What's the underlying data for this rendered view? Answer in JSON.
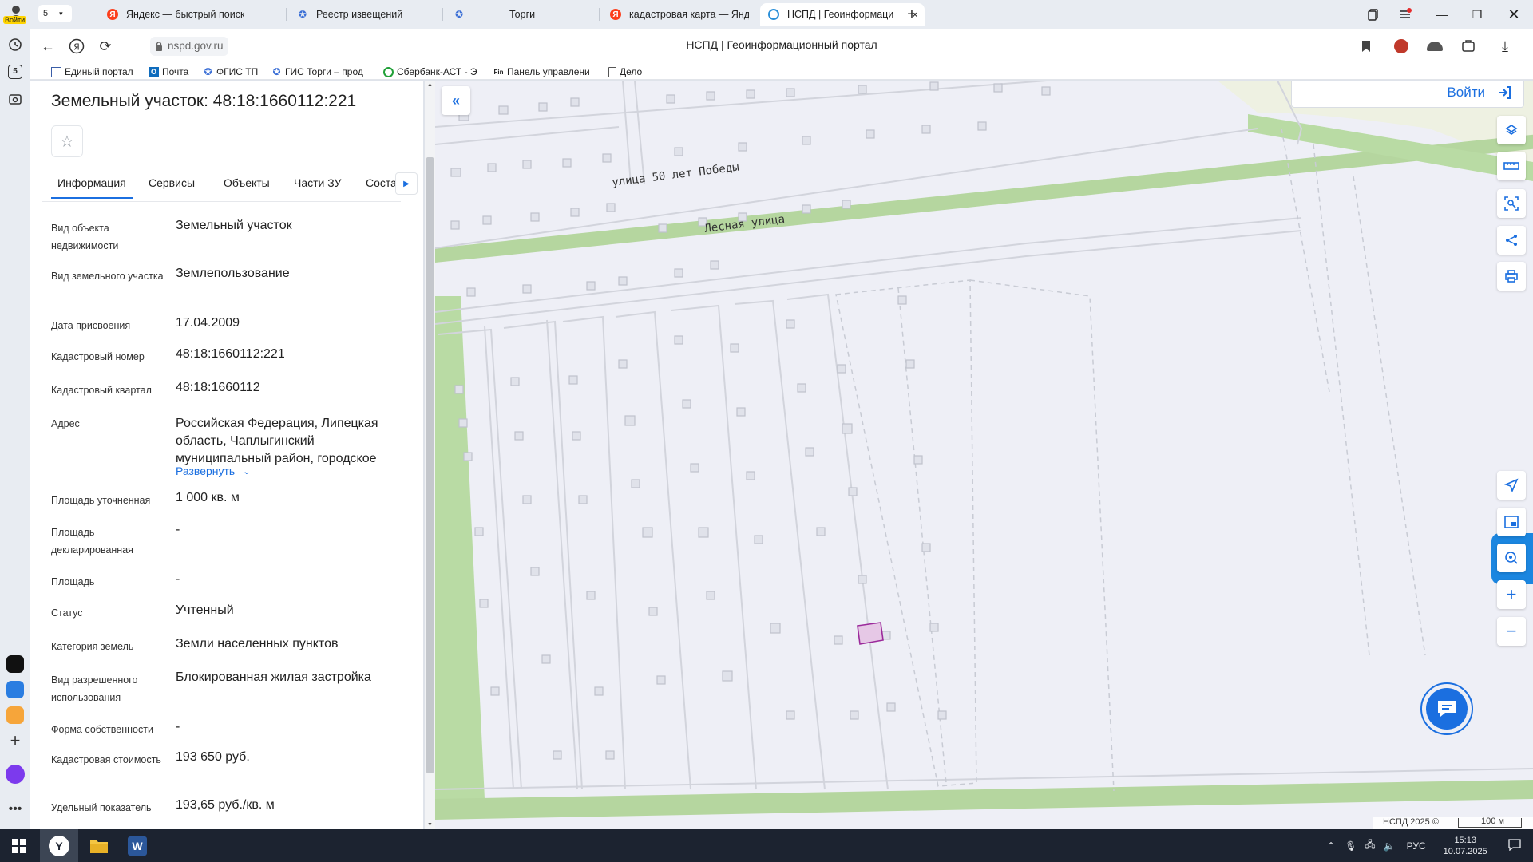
{
  "browser": {
    "profile_label": "Войти",
    "tab_counter": "5",
    "tabs": [
      {
        "title": "Яндекс — быстрый поиск"
      },
      {
        "title": "Реестр извещений"
      },
      {
        "title": "Торги"
      },
      {
        "title": "кадастровая карта — Янд"
      },
      {
        "title": "НСПД | Геоинформаци"
      }
    ],
    "url": "nspd.gov.ru",
    "page_title": "НСПД | Геоинформационный портал",
    "bookmarks": [
      {
        "label": "Единый портал"
      },
      {
        "label": "Почта"
      },
      {
        "label": "ФГИС ТП"
      },
      {
        "label": "ГИС Торги – прод"
      },
      {
        "label": "Сбербанк-АСТ - Э"
      },
      {
        "label": "Панель управлени"
      },
      {
        "label": "Дело"
      }
    ],
    "sidebar_counter": "5"
  },
  "panel": {
    "title": "Земельный участок: 48:18:1660112:221",
    "tabs": [
      {
        "label": "Информация",
        "active": true
      },
      {
        "label": "Сервисы"
      },
      {
        "label": "Объекты"
      },
      {
        "label": "Части ЗУ"
      },
      {
        "label": "Соста"
      }
    ],
    "rows": [
      {
        "label": "Вид объекта недвижимости",
        "value": "Земельный участок"
      },
      {
        "label": "Вид земельного участка",
        "value": "Землепользование"
      },
      {
        "label": "Дата присвоения",
        "value": "17.04.2009"
      },
      {
        "label": "Кадастровый номер",
        "value": "48:18:1660112:221"
      },
      {
        "label": "Кадастровый квартал",
        "value": "48:18:1660112"
      },
      {
        "label": "Адрес",
        "value": "Российская Федерация, Липецкая область, Чаплыгинский муниципальный район, городское"
      },
      {
        "label": "Площадь уточненная",
        "value": "1 000 кв. м"
      },
      {
        "label": "Площадь декларированная",
        "value": "-"
      },
      {
        "label": "Площадь",
        "value": "-"
      },
      {
        "label": "Статус",
        "value": "Учтенный"
      },
      {
        "label": "Категория земель",
        "value": "Земли населенных пунктов"
      },
      {
        "label": "Вид разрешенного использования",
        "value": "Блокированная жилая застройка"
      },
      {
        "label": "Форма собственности",
        "value": "-"
      },
      {
        "label": "Кадастровая стоимость",
        "value": "193 650 руб."
      },
      {
        "label": "Удельный показатель",
        "value": "193,65 руб./кв. м"
      }
    ],
    "expand_label": "Развернуть"
  },
  "map": {
    "login_label": "Войти",
    "streets": [
      {
        "name": "улица 50 лет Победы"
      },
      {
        "name": "Лесная улица"
      }
    ],
    "attribution": "НСПД 2025 ©",
    "scale_label": "100 м",
    "parcel_highlight_color": "#9b2a9b",
    "accent_color": "#1b6fe0"
  },
  "taskbar": {
    "language": "РУС",
    "time": "15:13",
    "date": "10.07.2025"
  }
}
